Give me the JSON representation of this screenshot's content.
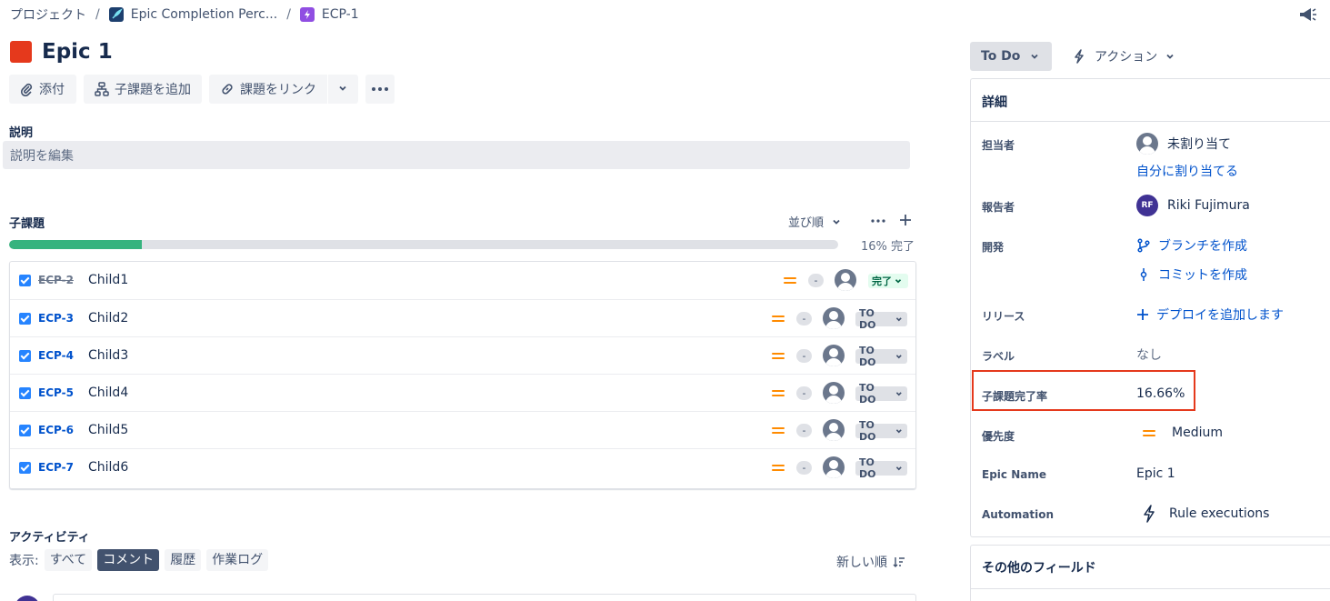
{
  "breadcrumb": {
    "project": "プロジェクト",
    "board": "Epic Completion Perc...",
    "issue": "ECP-1",
    "separator": "/"
  },
  "issue": {
    "title": "Epic 1",
    "type_color": "#e5391c"
  },
  "toolbar": {
    "attach": "添付",
    "add_child": "子課題を追加",
    "link": "課題をリンク"
  },
  "description": {
    "label": "説明",
    "placeholder": "説明を編集"
  },
  "children": {
    "label": "子課題",
    "sort_label": "並び順",
    "progress_percent": 16,
    "progress_text": "16% 完了",
    "items": [
      {
        "key": "ECP-2",
        "summary": "Child1",
        "estimate": "-",
        "status": "完了",
        "done": true
      },
      {
        "key": "ECP-3",
        "summary": "Child2",
        "estimate": "-",
        "status": "TO DO",
        "done": false
      },
      {
        "key": "ECP-4",
        "summary": "Child3",
        "estimate": "-",
        "status": "TO DO",
        "done": false
      },
      {
        "key": "ECP-5",
        "summary": "Child4",
        "estimate": "-",
        "status": "TO DO",
        "done": false
      },
      {
        "key": "ECP-6",
        "summary": "Child5",
        "estimate": "-",
        "status": "TO DO",
        "done": false
      },
      {
        "key": "ECP-7",
        "summary": "Child6",
        "estimate": "-",
        "status": "TO DO",
        "done": false
      }
    ]
  },
  "activity": {
    "label": "アクティビティ",
    "show_label": "表示:",
    "filters": [
      "すべて",
      "コメント",
      "履歴",
      "作業ログ"
    ],
    "active_filter": "コメント",
    "sort_label": "新しい順"
  },
  "side": {
    "status": "To Do",
    "actions": "アクション",
    "details_title": "詳細",
    "fields": {
      "assignee_label": "担当者",
      "assignee_value": "未割り当て",
      "assign_self": "自分に割り当てる",
      "reporter_label": "報告者",
      "reporter_initials": "RF",
      "reporter_name": "Riki Fujimura",
      "dev_label": "開発",
      "create_branch": "ブランチを作成",
      "create_commit": "コミットを作成",
      "release_label": "リリース",
      "add_deploy": "デプロイを追加します",
      "labels_label": "ラベル",
      "labels_value": "なし",
      "child_rate_label": "子課題完了率",
      "child_rate_value": "16.66%",
      "priority_label": "優先度",
      "priority_value": "Medium",
      "epic_name_label": "Epic Name",
      "epic_name_value": "Epic 1",
      "automation_label": "Automation",
      "automation_value": "Rule executions"
    },
    "other_fields_title": "その他のフィールド"
  },
  "colors": {
    "accent": "#0052cc",
    "progress": "#36b37e",
    "highlight": "#e5391c",
    "priority_medium": "#ff8b00"
  }
}
